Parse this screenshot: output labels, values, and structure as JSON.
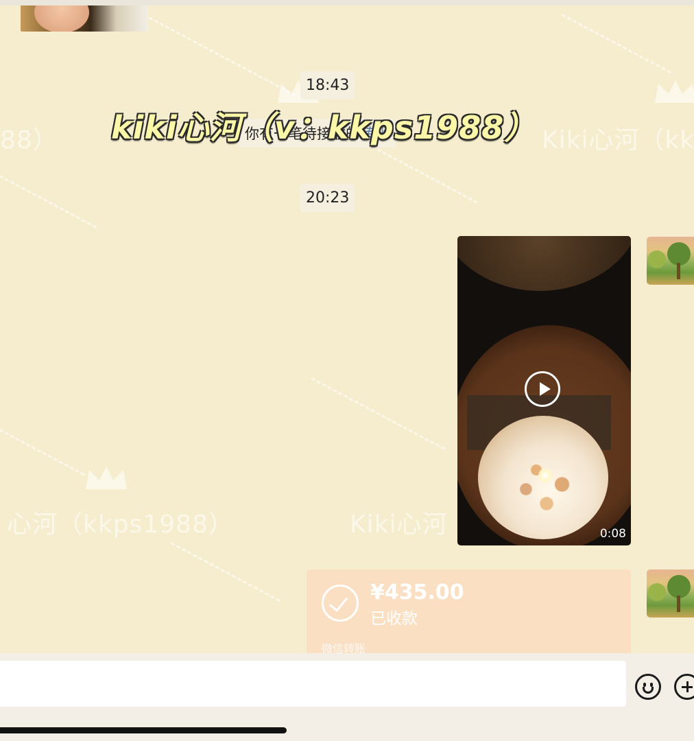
{
  "timestamps": {
    "first": "18:43",
    "second": "20:23"
  },
  "system_message": {
    "text": "你有一笔待接收的",
    "link": "转账"
  },
  "overlay_title": "kiki心河（v：kkps1988）",
  "watermark": {
    "texts": [
      "Kiki心河（kk",
      "88）",
      "心河（kkps1988）",
      "Kiki心河"
    ],
    "color": "#ffffff"
  },
  "video_message": {
    "duration": "0:08"
  },
  "transfer_card": {
    "amount": "¥435.00",
    "status": "已收款",
    "footer": "微信转账",
    "color": "#fbdfc2"
  },
  "colors": {
    "background": "#f6edcf",
    "pill": "#f5efdf",
    "link": "#5a7aa8"
  }
}
